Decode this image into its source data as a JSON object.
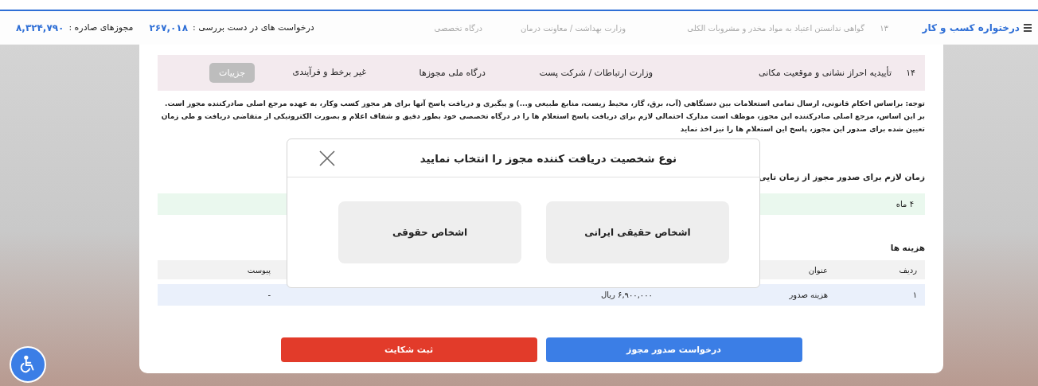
{
  "header": {
    "brand": "درختواره کسب و کار",
    "stats": [
      {
        "label": "درخواست های در دست بررسی :",
        "value": "۲۶۷,۰۱۸"
      },
      {
        "label": "مجوزهای صادره :",
        "value": "۸,۳۲۴,۷۹۰"
      }
    ]
  },
  "license_rows": [
    {
      "number": "۱۳",
      "title": "گواهی ندانستن اعتیاد به مواد مخدر و مشروبات الکلی",
      "authority": "وزارت بهداشت / معاونت درمان",
      "portal": "درگاه تخصصی",
      "faded": true
    },
    {
      "number": "۱۴",
      "title": "تأییدیه احراز نشانی و موقعیت مکانی",
      "authority": "وزارت ارتباطات / شرکت پست",
      "portal": "درگاه ملی مجوزها",
      "mode": "غیر برخط و فرآیندی",
      "action": {
        "label": "جزییات",
        "disabled": true
      },
      "faded": false
    }
  ],
  "note": "توجه: براساس احکام قانونی، ارسال تمامی استعلامات بین دستگاهی (آب، برق، گاز، محیط زیست، منابع طبیعی و...) و پیگیری و دریافت پاسخ آنها برای هر مجوز کسب وکار، به عهده مرجع اصلی صادرکننده مجوز است. بر این اساس، مرجع اصلی صادرکننده این مجوز، موظف است مدارک احتمالی لازم برای دریافت پاسخ استعلام ها را در درگاه تخصصی خود بطور دقیق و شفاف اعلام و بصورت الکترونیکی از متقاضی دریافت و طی زمان تعیین شده برای صدور این مجوز، پاسخ این استعلام ها را نیز اخذ نماید",
  "duration": {
    "heading": "زمان لازم برای صدور مجوز از زمان تایی",
    "value": "۴ ماه"
  },
  "costs": {
    "heading": "هزینه ها",
    "columns": [
      {
        "label": "ردیف"
      },
      {
        "label": "عنوان"
      },
      {},
      {
        "label": "پیوست"
      }
    ],
    "rows": [
      [
        "۱",
        "هزینه صدور",
        "۶,۹۰۰,۰۰۰ ریال",
        "-"
      ]
    ]
  },
  "actions": [
    {
      "label": "درخواست صدور مجوز",
      "kind": "primary"
    },
    {
      "label": "ثبت شکایت",
      "kind": "danger"
    }
  ],
  "modal": {
    "title": "نوع شخصیت دریافت کننده مجوز را انتخاب نمایید",
    "options": [
      {
        "label": "اشخاص حقیقی ایرانی"
      },
      {
        "label": "اشخاص حقوقی"
      }
    ]
  }
}
